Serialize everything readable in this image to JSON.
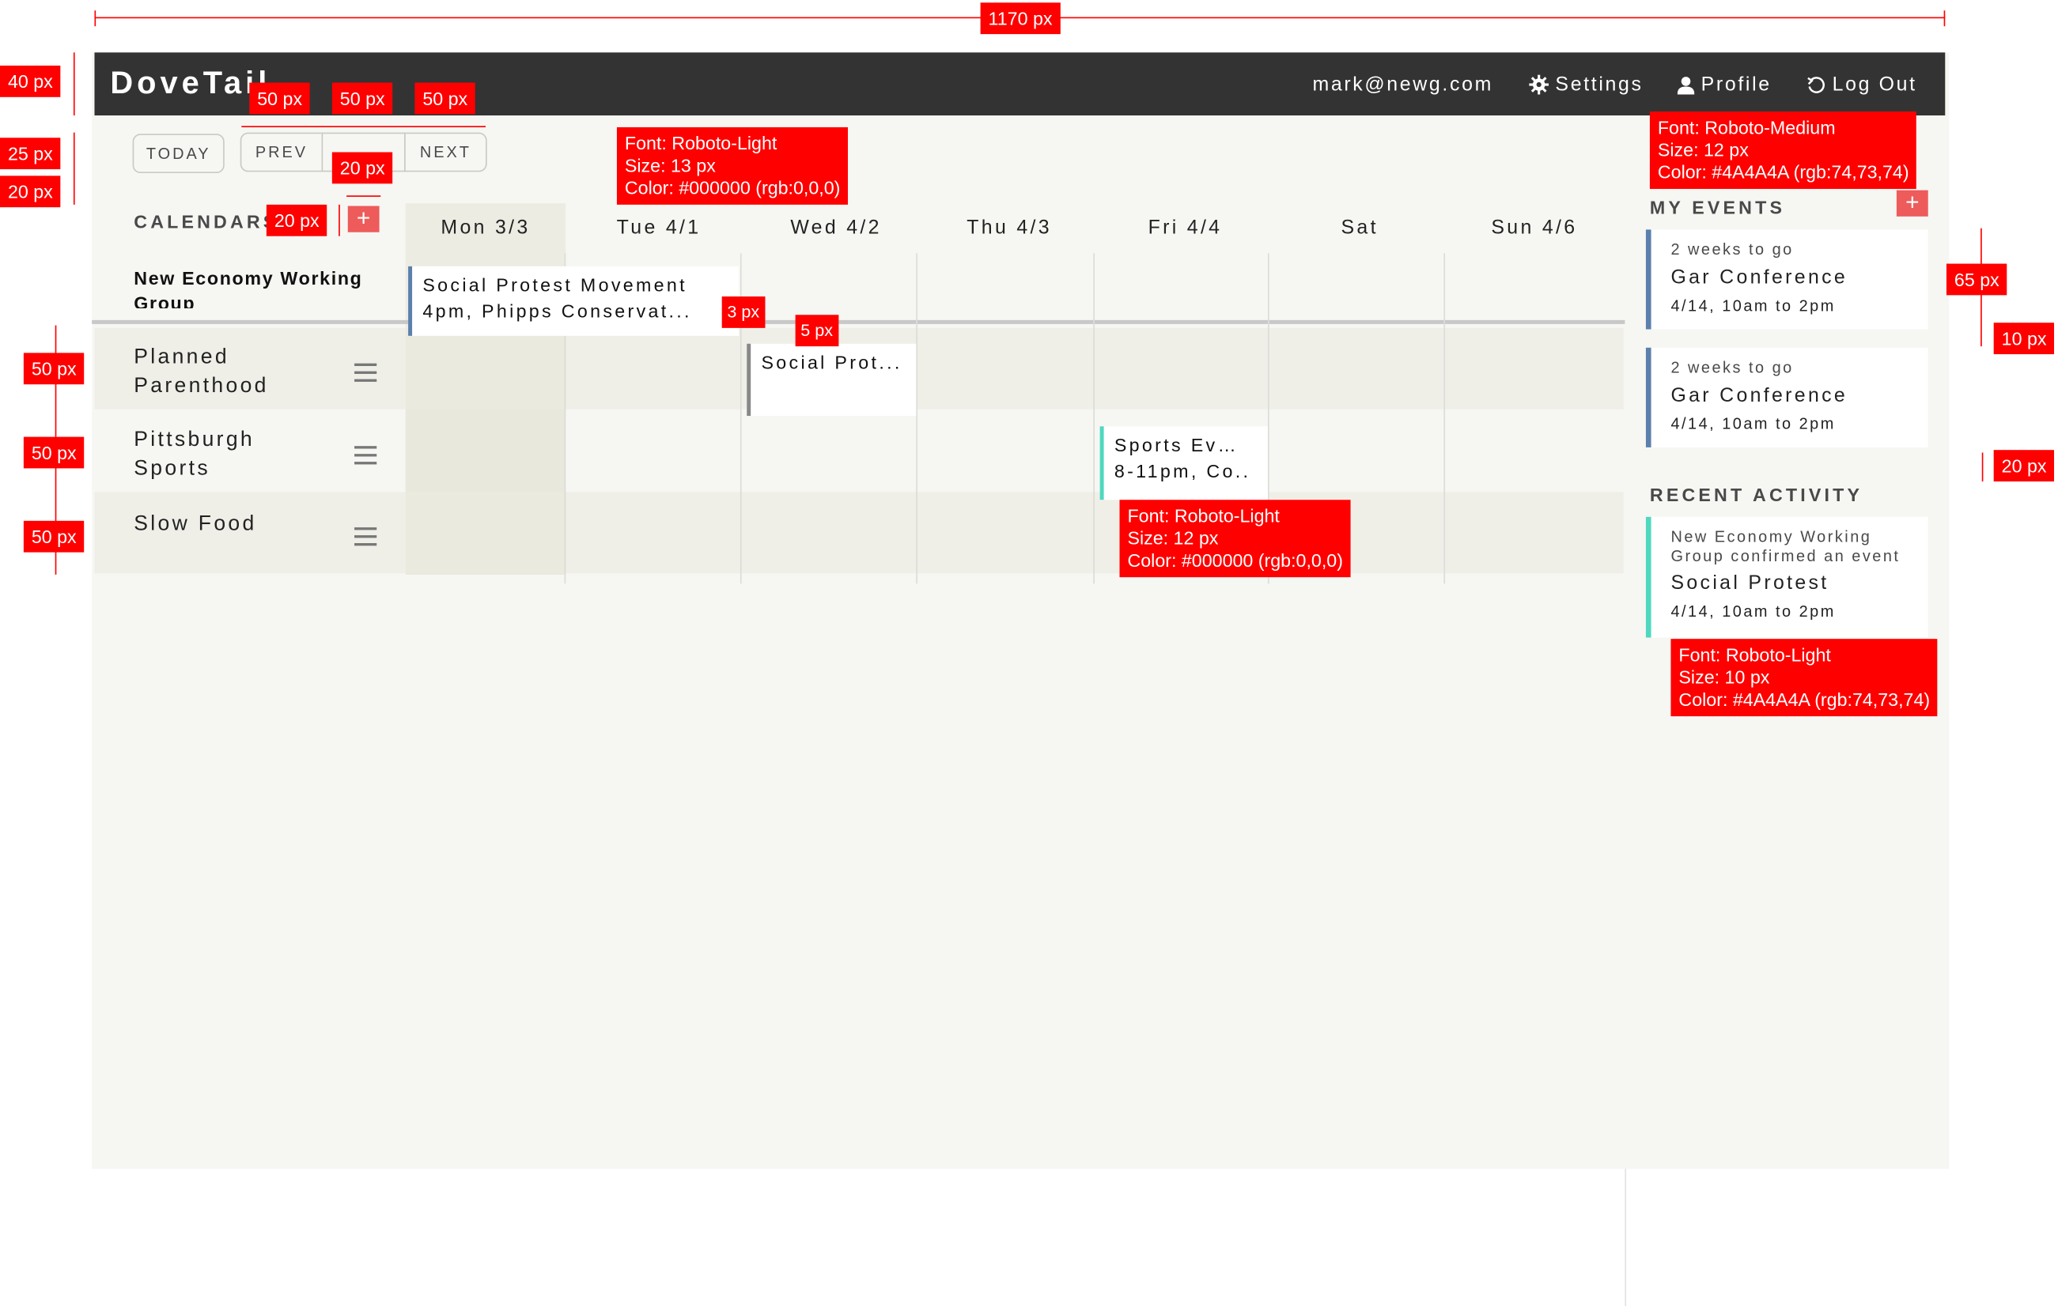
{
  "app": {
    "logo": "DoveTail"
  },
  "header": {
    "email": "mark@newg.com",
    "settings_label": "Settings",
    "profile_label": "Profile",
    "logout_label": "Log Out"
  },
  "toolbar": {
    "today_label": "TODAY",
    "prev_label": "PREV",
    "middle_label": "",
    "next_label": "NEXT"
  },
  "sidebar": {
    "calendars_heading": "CALENDARS",
    "plus": "+",
    "top_calendar": "New Economy Working Group",
    "calendars": [
      {
        "name": "Planned Parenthood"
      },
      {
        "name": "Pittsburgh Sports"
      },
      {
        "name": "Slow Food"
      }
    ]
  },
  "days": [
    "Mon 3/3",
    "Tue 4/1",
    "Wed 4/2",
    "Thu 4/3",
    "Fri 4/4",
    "Sat",
    "Sun 4/6"
  ],
  "events": [
    {
      "line1": "Social Protest Movement",
      "line2": "4pm, Phipps Conservat...",
      "color": "#5b80ac"
    },
    {
      "line1": "Social Prot...",
      "line2": "",
      "color": "#888888"
    },
    {
      "line1": "Sports Ev…",
      "line2": "8-11pm, Co..",
      "color": "#4fd8bf"
    }
  ],
  "my_events": {
    "heading": "MY EVENTS",
    "plus": "+",
    "items": [
      {
        "sub": "2 weeks to go",
        "title": "Gar Conference",
        "when": "4/14, 10am to 2pm"
      },
      {
        "sub": "2 weeks to go",
        "title": "Gar Conference",
        "when": "4/14, 10am to 2pm"
      }
    ]
  },
  "recent_activity": {
    "heading": "RECENT ACTIVITY",
    "items": [
      {
        "sub": "New Economy Working Group confirmed an event",
        "title": "Social Protest",
        "when": "4/14, 10am to 2pm",
        "color": "#4fd8bf"
      }
    ]
  },
  "annotations": {
    "width_total": "1170 px",
    "topbar_h": "40 px",
    "btn_h": "25 px",
    "gap_h": "20 px",
    "btn_w1": "50 px",
    "btn_w2": "50 px",
    "btn_w3": "50 px",
    "plus_size": "20 px",
    "plus_h": "20 px",
    "font1": [
      "Font: Roboto-Light",
      "Size: 13 px",
      "Color: #000000 (rgb:0,0,0)"
    ],
    "font2": [
      "Font: Roboto-Medium",
      "Size: 12 px",
      "Color: #4A4A4A (rgb:74,73,74)"
    ],
    "font3": [
      "Font: Roboto-Light",
      "Size: 12 px",
      "Color: #000000 (rgb:0,0,0)"
    ],
    "font4": [
      "Font: Roboto-Light",
      "Size: 10 px",
      "Color: #4A4A4A (rgb:74,73,74)"
    ],
    "event_border": "3 px",
    "event_gap": "5 px",
    "row1": "50 px",
    "row2": "50 px",
    "row3": "50 px",
    "card_h": "65 px",
    "card_gap": "10 px",
    "section_gap": "20 px"
  }
}
